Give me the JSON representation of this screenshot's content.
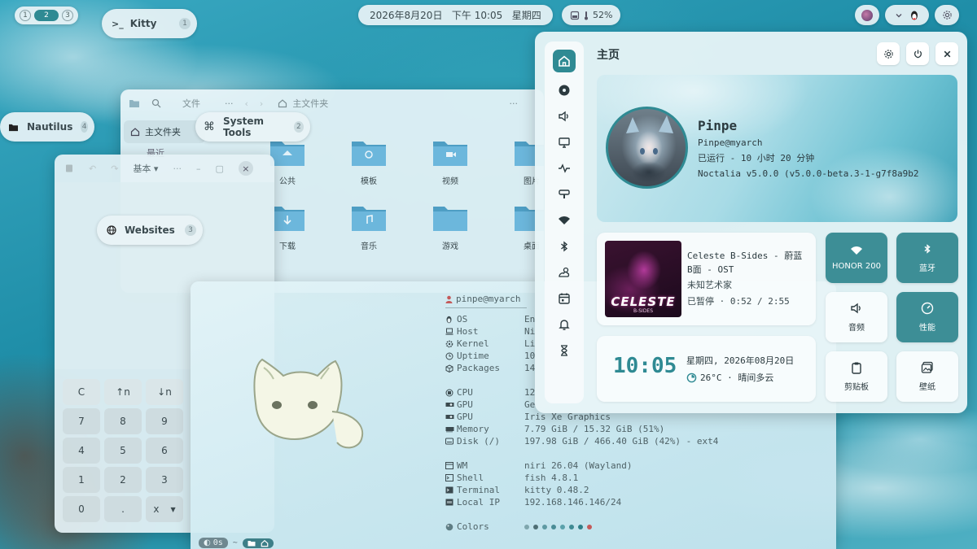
{
  "workspaces": {
    "items": [
      "1",
      "2",
      "3"
    ],
    "active": 1
  },
  "topbar": {
    "datetime": "2026年8月20日   下午 10:05   星期四",
    "battery": "52%"
  },
  "labels": {
    "kitty": {
      "name": "Kitty",
      "count": "1"
    },
    "nautilus": {
      "name": "Nautilus",
      "count": "4"
    },
    "system_tools": {
      "name": "System Tools",
      "count": "2"
    },
    "websites": {
      "name": "Websites",
      "count": "3"
    }
  },
  "file_manager": {
    "menu_label": "文件",
    "path": "主文件夹",
    "sidebar": [
      "主文件夹",
      "最近"
    ],
    "folders": [
      "公共",
      "模板",
      "视频",
      "图片",
      "下载",
      "音乐",
      "游戏",
      "桌面"
    ]
  },
  "calculator": {
    "mode": "基本",
    "keys": [
      [
        "C",
        "↑n",
        "↓n"
      ],
      [
        "7",
        "8",
        "9"
      ],
      [
        "4",
        "5",
        "6"
      ],
      [
        "1",
        "2",
        "3"
      ],
      [
        "0",
        ".",
        "x"
      ]
    ]
  },
  "terminal": {
    "user": "pinpe@myarch",
    "rows": [
      {
        "key": "OS",
        "value": "En",
        "icon": "linux-icon"
      },
      {
        "key": "Host",
        "value": "Ni",
        "icon": "laptop-icon"
      },
      {
        "key": "Kernel",
        "value": "Li",
        "icon": "gear-icon"
      },
      {
        "key": "Uptime",
        "value": "10",
        "icon": "clock-icon"
      },
      {
        "key": "Packages",
        "value": "14",
        "icon": "package-icon"
      },
      {
        "key": "",
        "value": "",
        "icon": ""
      },
      {
        "key": "CPU",
        "value": "12",
        "icon": "cpu-icon"
      },
      {
        "key": "GPU",
        "value": "Ge",
        "icon": "gpu-icon"
      },
      {
        "key": "GPU",
        "value": "Iris Xe Graphics",
        "icon": "gpu-icon"
      },
      {
        "key": "Memory",
        "value": "7.79 GiB / 15.32 GiB (51%)",
        "icon": "memory-icon"
      },
      {
        "key": "Disk (/)",
        "value": "197.98 GiB / 466.40 GiB (42%) - ext4",
        "icon": "disk-icon"
      },
      {
        "key": "",
        "value": "",
        "icon": ""
      },
      {
        "key": "WM",
        "value": "niri 26.04 (Wayland)",
        "icon": "window-icon"
      },
      {
        "key": "Shell",
        "value": "fish 4.8.1",
        "icon": "shell-icon"
      },
      {
        "key": "Terminal",
        "value": "kitty 0.48.2",
        "icon": "terminal-icon"
      },
      {
        "key": "Local IP",
        "value": "192.168.146.146/24",
        "icon": "network-icon"
      }
    ],
    "colors_label": "Colors",
    "palette": [
      "#7fa6ad",
      "#4f6e74",
      "#5f9aa3",
      "#4a8c96",
      "#5aa1ab",
      "#3e8a93",
      "#2f7f88",
      "#c45a5a"
    ],
    "prompt_time": "0s",
    "prompt_tilde": "~"
  },
  "control_center": {
    "title": "主页",
    "profile": {
      "name": "Pinpe",
      "user": "Pinpe@myarch",
      "uptime": "已运行 - 10 小时 20 分钟",
      "version": "Noctalia v5.0.0 (v5.0.0-beta.3-1-g7f8a9b2"
    },
    "media": {
      "title": "Celeste B-Sides - 蔚蓝 B面 - OST",
      "artist": "未知艺术家",
      "status": "已暂停 · 0:52 / 2:55",
      "cover_text": "CELESTE",
      "cover_sub": "B-SIDES"
    },
    "clock": {
      "time": "10:05",
      "date": "星期四, 2026年08月20日",
      "weather": "26°C · 晴间多云"
    },
    "tiles": [
      {
        "label": "HONOR 200",
        "icon": "wifi-icon",
        "active": true
      },
      {
        "label": "蓝牙",
        "icon": "bluetooth-icon",
        "active": true
      },
      {
        "label": "音频",
        "icon": "volume-icon",
        "active": false
      },
      {
        "label": "性能",
        "icon": "gauge-icon",
        "active": true
      },
      {
        "label": "剪贴板",
        "icon": "clipboard-icon",
        "active": false
      },
      {
        "label": "壁纸",
        "icon": "wallpaper-icon",
        "active": false
      }
    ]
  },
  "colors": {
    "accent": "#2f8a93",
    "panel": "#e8f3f6"
  }
}
